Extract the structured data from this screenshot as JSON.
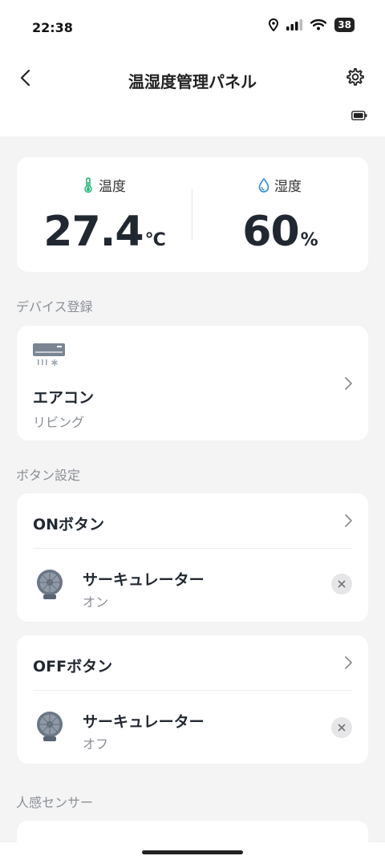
{
  "status": {
    "time": "22:38",
    "battery_level": "38"
  },
  "header": {
    "title": "温湿度管理パネル",
    "back_icon": "chevron-left-icon",
    "settings_icon": "gear-icon"
  },
  "measurements": {
    "temperature": {
      "label": "温度",
      "value": "27.4",
      "unit": "°C",
      "icon": "thermometer-icon",
      "color": "#2bb57a"
    },
    "humidity": {
      "label": "湿度",
      "value": "60",
      "unit": "%",
      "icon": "droplet-icon",
      "color": "#3a8fd6"
    }
  },
  "device_section": {
    "label": "デバイス登録",
    "device": {
      "name": "エアコン",
      "location": "リビング",
      "icon": "air-conditioner-icon"
    }
  },
  "button_section": {
    "label": "ボタン設定",
    "on_button": {
      "title": "ONボタン",
      "action": {
        "device": "サーキュレーター",
        "state": "オン",
        "icon": "circulator-fan-icon"
      }
    },
    "off_button": {
      "title": "OFFボタン",
      "action": {
        "device": "サーキュレーター",
        "state": "オフ",
        "icon": "circulator-fan-icon"
      }
    }
  },
  "motion_section": {
    "label": "人感センサー"
  }
}
